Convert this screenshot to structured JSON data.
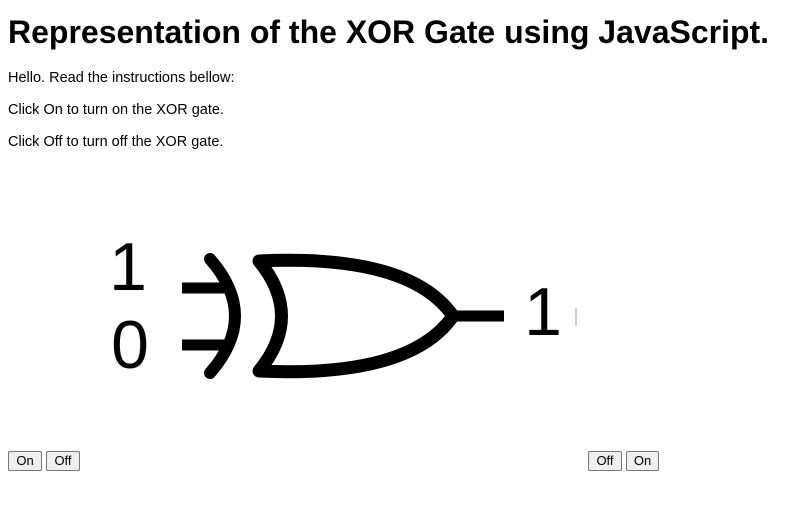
{
  "page": {
    "title": "Representation of the XOR Gate using JavaScript.",
    "paragraphs": [
      "Hello. Read the instructions bellow:",
      "Click On to turn on the XOR gate.",
      "Click Off to turn off the XOR gate."
    ]
  },
  "gate": {
    "input_a": "1",
    "input_b": "0",
    "output": "1",
    "icon": "xor-gate-icon"
  },
  "controls": {
    "left": {
      "on_label": "On",
      "off_label": "Off"
    },
    "right": {
      "off_label": "Off",
      "on_label": "On"
    }
  },
  "colors": {
    "text": "#000000",
    "background": "#ffffff",
    "button_bg": "#efefef",
    "button_border": "#767676"
  }
}
